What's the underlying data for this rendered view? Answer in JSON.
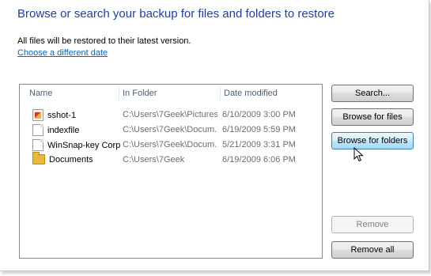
{
  "heading": "Browse or search your backup for files and folders to restore",
  "info": "All files will be restored to their latest version.",
  "link": "Choose a different date",
  "list": {
    "columns": [
      "Name",
      "In Folder",
      "Date modified"
    ],
    "rows": [
      {
        "icon": "image-file-icon",
        "name": "sshot-1",
        "folder": "C:\\Users\\7Geek\\Pictures",
        "date": "6/10/2009 3:00 PM"
      },
      {
        "icon": "document-file-icon",
        "name": "indexfile",
        "folder": "C:\\Users\\7Geek\\Docum...",
        "date": "6/19/2009 5:59 PM"
      },
      {
        "icon": "document-file-icon",
        "name": "WinSnap-key Corp",
        "folder": "C:\\Users\\7Geek\\Docum...",
        "date": "5/21/2009 3:31 PM"
      },
      {
        "icon": "folder-icon",
        "name": "Documents",
        "folder": "C:\\Users\\7Geek",
        "date": "6/19/2009 6:06 PM"
      }
    ]
  },
  "buttons": {
    "search": "Search...",
    "browse_files": "Browse for files",
    "browse_folders": "Browse for folders",
    "remove": "Remove",
    "remove_all": "Remove all"
  },
  "colors": {
    "heading": "#1e3ea8",
    "link": "#0066cc",
    "hover_button": "#bee6fd"
  }
}
